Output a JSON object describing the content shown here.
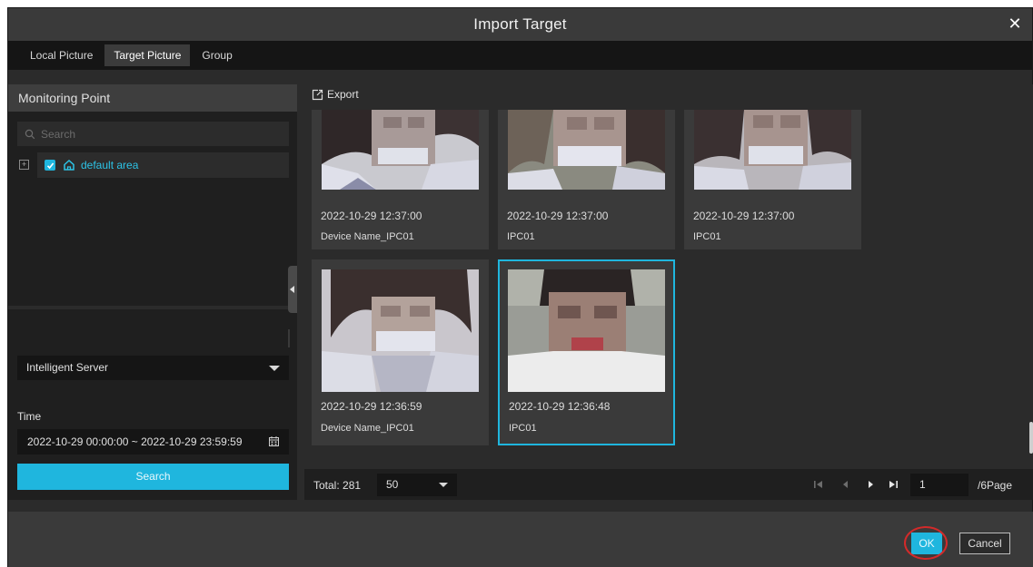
{
  "title": "Import Target",
  "close_icon": "close-icon",
  "tabs": [
    {
      "label": "Local Picture",
      "active": false
    },
    {
      "label": "Target Picture",
      "active": true
    },
    {
      "label": "Group",
      "active": false
    }
  ],
  "left": {
    "header": "Monitoring Point",
    "search_placeholder": "Search",
    "tree": {
      "label": "default area",
      "checked": true
    },
    "server_select": "Intelligent Server",
    "time_label": "Time",
    "time_range": "2022-10-29 00:00:00 ~ 2022-10-29 23:59:59",
    "search_button": "Search"
  },
  "right": {
    "export_label": "Export",
    "cards": [
      {
        "time": "2022-10-29 12:37:00",
        "device": "Device Name_IPC01",
        "selected": false
      },
      {
        "time": "2022-10-29 12:37:00",
        "device": "IPC01",
        "selected": false
      },
      {
        "time": "2022-10-29 12:37:00",
        "device": "IPC01",
        "selected": false
      },
      {
        "time": "2022-10-29 12:36:59",
        "device": "Device Name_IPC01",
        "selected": false
      },
      {
        "time": "2022-10-29 12:36:48",
        "device": "IPC01",
        "selected": true
      }
    ],
    "pager": {
      "total": "Total: 281",
      "page_size": "50",
      "current_page": "1",
      "page_count": "/6Page"
    }
  },
  "footer": {
    "ok_label": "OK",
    "cancel_label": "Cancel"
  },
  "colors": {
    "accent": "#1fb6de",
    "highlight_ring": "#d32a2a"
  }
}
